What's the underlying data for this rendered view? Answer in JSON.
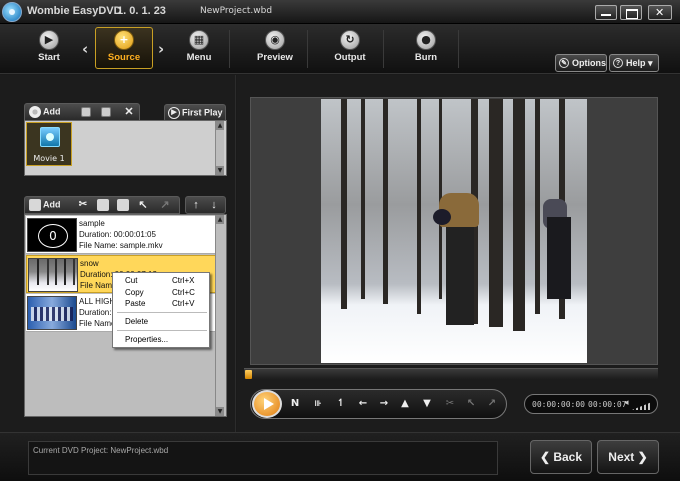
{
  "window": {
    "app_title": "Wombie EasyDVD",
    "version": "1. 0. 1. 23",
    "project_file": "NewProject.wbd"
  },
  "toolbar": {
    "items": [
      {
        "label": "Start",
        "icon": "play-icon"
      },
      {
        "label": "Source",
        "icon": "plus-icon",
        "active": true
      },
      {
        "label": "Menu",
        "icon": "grid-icon"
      },
      {
        "label": "Preview",
        "icon": "eye-icon"
      },
      {
        "label": "Output",
        "icon": "export-icon"
      },
      {
        "label": "Burn",
        "icon": "disc-icon"
      }
    ],
    "options_label": "Options",
    "help_label": "Help"
  },
  "menu_panel": {
    "add_label": "Add",
    "first_play_label": "First Play",
    "movies": [
      {
        "label": "Movie 1"
      }
    ]
  },
  "title_panel": {
    "add_label": "Add",
    "titles": [
      {
        "name": "sample",
        "duration": "Duration: 00:00:01:05",
        "file": "File Name: sample.mkv"
      },
      {
        "name": "snow",
        "duration": "Duration: 00:00:07:13",
        "file": "File Name:"
      },
      {
        "name": "ALL HIGH",
        "duration": "Duration: 0",
        "file": "File Name:"
      }
    ]
  },
  "context_menu": {
    "items": [
      {
        "label": "Cut",
        "shortcut": "Ctrl+X"
      },
      {
        "label": "Copy",
        "shortcut": "Ctrl+C"
      },
      {
        "label": "Paste",
        "shortcut": "Ctrl+V"
      },
      {
        "label": "Delete",
        "shortcut": ""
      },
      {
        "label": "Properties...",
        "shortcut": ""
      }
    ]
  },
  "player": {
    "current_time": "00:00:00:00",
    "total_time": "00:00:07"
  },
  "footer": {
    "status": "Current DVD Project: NewProject.wbd",
    "back_label": "Back",
    "next_label": "Next"
  },
  "colors": {
    "accent": "#e8a020",
    "selected_row": "#ffd75a",
    "background": "#1a1a1a"
  }
}
